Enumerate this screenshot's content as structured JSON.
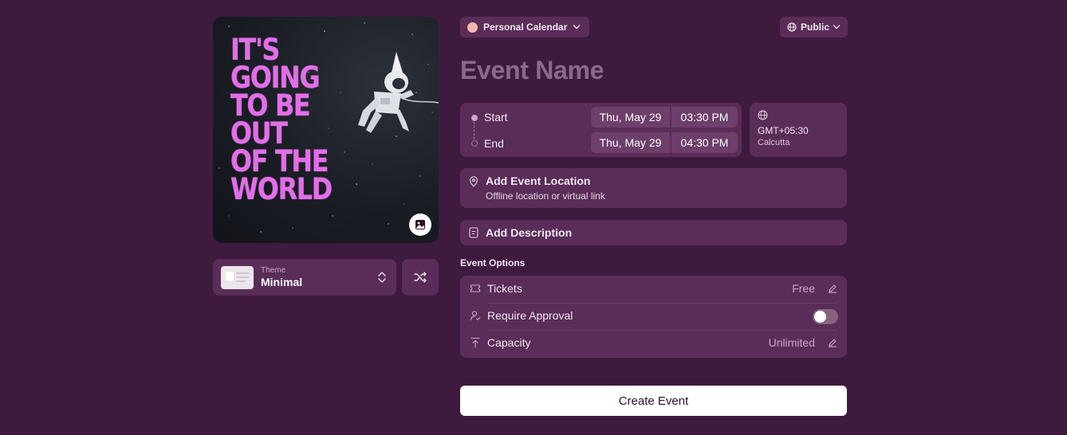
{
  "cover": {
    "headline": "IT'S\nGOING\nTO BE\nOUT\nOF THE\nWORLD",
    "upload_icon": "image-icon"
  },
  "theme": {
    "caption": "Theme",
    "name": "Minimal"
  },
  "calendar": {
    "label": "Personal Calendar",
    "dot_color": "#f2b7b0"
  },
  "visibility": {
    "label": "Public"
  },
  "event_name": {
    "placeholder": "Event Name"
  },
  "schedule": {
    "start": {
      "label": "Start",
      "date": "Thu, May 29",
      "time": "03:30 PM"
    },
    "end": {
      "label": "End",
      "date": "Thu, May 29",
      "time": "04:30 PM"
    }
  },
  "timezone": {
    "offset": "GMT+05:30",
    "city": "Calcutta"
  },
  "location": {
    "title": "Add Event Location",
    "subtitle": "Offline location or virtual link"
  },
  "description": {
    "title": "Add Description"
  },
  "options": {
    "heading": "Event Options",
    "tickets": {
      "label": "Tickets",
      "value": "Free"
    },
    "approval": {
      "label": "Require Approval",
      "enabled": false
    },
    "capacity": {
      "label": "Capacity",
      "value": "Unlimited"
    }
  },
  "create_button": "Create Event",
  "colors": {
    "background": "#3f1a3f",
    "card": "#5a2d58",
    "headline": "#e26ee8"
  }
}
